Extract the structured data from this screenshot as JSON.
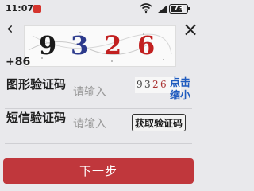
{
  "status_bar": {
    "time": "11:07",
    "battery": "73",
    "icons": [
      "app-notification-icon",
      "wifi-icon",
      "signal-icon",
      "battery-icon"
    ]
  },
  "header": {
    "back_icon": "chevron-left-icon",
    "close_icon": "close-icon"
  },
  "captcha_image": {
    "characters": [
      "9",
      "3",
      "2",
      "6"
    ],
    "colors": [
      "#1a1a1a",
      "#2c3a8c",
      "#c22020",
      "#c22020"
    ]
  },
  "phone": {
    "country_code": "+86"
  },
  "form": {
    "image_code": {
      "label": "图形验证码",
      "placeholder": "请输入",
      "captcha_text": [
        "9",
        "3",
        "2",
        "6"
      ],
      "refresh_label": "点击缩小"
    },
    "sms_code": {
      "label": "短信验证码",
      "placeholder": "请输入",
      "get_code_label": "获取验证码"
    }
  },
  "next_button": {
    "label": "下一步",
    "color": "#c0373c"
  },
  "colors": {
    "background": "#e9e9ec",
    "link": "#1f5bbf"
  }
}
